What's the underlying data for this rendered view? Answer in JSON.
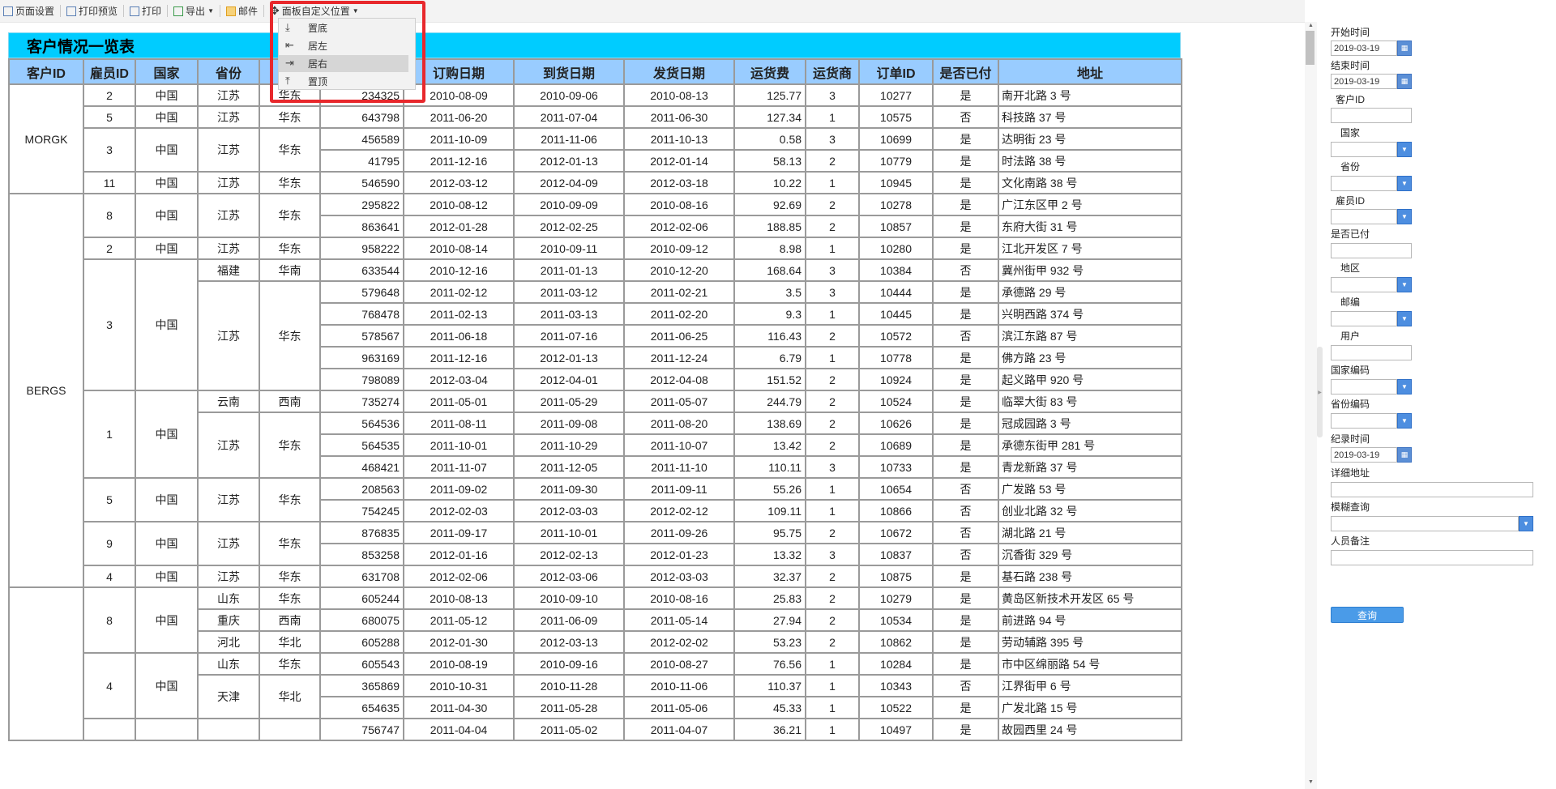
{
  "toolbar": {
    "items": [
      {
        "label": "页面设置",
        "icon": "page-setup-icon"
      },
      {
        "label": "打印预览",
        "icon": "print-preview-icon"
      },
      {
        "label": "打印",
        "icon": "printer-icon"
      },
      {
        "label": "导出",
        "icon": "export-icon"
      },
      {
        "label": "邮件",
        "icon": "mail-icon"
      },
      {
        "label": "面板自定义位置",
        "icon": "move-icon"
      }
    ]
  },
  "panel_menu": {
    "items": [
      {
        "label": "置底",
        "glyph": "⤓",
        "icon": "align-bottom-icon"
      },
      {
        "label": "居左",
        "glyph": "⇤",
        "icon": "align-left-icon"
      },
      {
        "label": "居右",
        "glyph": "⇥",
        "icon": "align-right-icon"
      },
      {
        "label": "置顶",
        "glyph": "⤒",
        "icon": "align-top-icon"
      }
    ],
    "active_index": 2,
    "highlight_color": "#e8282c"
  },
  "report": {
    "title": "客户情况一览表",
    "title_bg": "#00ccff",
    "header_bg": "#99ccff",
    "columns": [
      "客户ID",
      "雇员ID",
      "国家",
      "省份",
      "地",
      "订购日期",
      "到货日期",
      "发货日期",
      "运货费",
      "运货商",
      "订单ID",
      "是否已付",
      "地址"
    ],
    "customers": [
      {
        "name": "MORGK",
        "span": 5
      },
      {
        "name": "BERGS",
        "span": 18
      },
      {
        "name": "",
        "span": 7
      }
    ],
    "employees": [
      {
        "id": "2",
        "country": "中国",
        "span": 1
      },
      {
        "id": "5",
        "country": "中国",
        "span": 1
      },
      {
        "id": "3",
        "country": "中国",
        "span": 2
      },
      {
        "id": "11",
        "country": "中国",
        "span": 1
      },
      {
        "id": "8",
        "country": "中国",
        "span": 2
      },
      {
        "id": "2",
        "country": "中国",
        "span": 1
      },
      {
        "id": "3",
        "country": "中国",
        "span": 6
      },
      {
        "id": "1",
        "country": "中国",
        "span": 4
      },
      {
        "id": "5",
        "country": "中国",
        "span": 2
      },
      {
        "id": "9",
        "country": "中国",
        "span": 2
      },
      {
        "id": "4",
        "country": "中国",
        "span": 1
      },
      {
        "id": "8",
        "country": "中国",
        "span": 3
      },
      {
        "id": "4",
        "country": "中国",
        "span": 3
      },
      {
        "id": "",
        "country": "",
        "span": 1
      }
    ],
    "provinces": [
      {
        "province": "江苏",
        "region": "华东",
        "span": 1
      },
      {
        "province": "江苏",
        "region": "华东",
        "span": 1
      },
      {
        "province": "江苏",
        "region": "华东",
        "span": 2
      },
      {
        "province": "江苏",
        "region": "华东",
        "span": 1
      },
      {
        "province": "江苏",
        "region": "华东",
        "span": 2
      },
      {
        "province": "江苏",
        "region": "华东",
        "span": 1
      },
      {
        "province": "福建",
        "region": "华南",
        "span": 1
      },
      {
        "province": "江苏",
        "region": "华东",
        "span": 5
      },
      {
        "province": "云南",
        "region": "西南",
        "span": 1
      },
      {
        "province": "江苏",
        "region": "华东",
        "span": 3
      },
      {
        "province": "江苏",
        "region": "华东",
        "span": 2
      },
      {
        "province": "江苏",
        "region": "华东",
        "span": 2
      },
      {
        "province": "江苏",
        "region": "华东",
        "span": 1
      },
      {
        "province": "山东",
        "region": "华东",
        "span": 1
      },
      {
        "province": "重庆",
        "region": "西南",
        "span": 1
      },
      {
        "province": "河北",
        "region": "华北",
        "span": 1
      },
      {
        "province": "山东",
        "region": "华东",
        "span": 1
      },
      {
        "province": "天津",
        "region": "华北",
        "span": 2
      },
      {
        "province": "",
        "region": "",
        "span": 1
      }
    ],
    "rows": [
      [
        "234325",
        "2010-08-09",
        "2010-09-06",
        "2010-08-13",
        "125.77",
        "3",
        "10277",
        "是",
        "南开北路 3 号"
      ],
      [
        "643798",
        "2011-06-20",
        "2011-07-04",
        "2011-06-30",
        "127.34",
        "1",
        "10575",
        "否",
        "科技路 37 号"
      ],
      [
        "456589",
        "2011-10-09",
        "2011-11-06",
        "2011-10-13",
        "0.58",
        "3",
        "10699",
        "是",
        "达明街 23 号"
      ],
      [
        "41795",
        "2011-12-16",
        "2012-01-13",
        "2012-01-14",
        "58.13",
        "2",
        "10779",
        "是",
        "时法路 38 号"
      ],
      [
        "546590",
        "2012-03-12",
        "2012-04-09",
        "2012-03-18",
        "10.22",
        "1",
        "10945",
        "是",
        "文化南路 38 号"
      ],
      [
        "295822",
        "2010-08-12",
        "2010-09-09",
        "2010-08-16",
        "92.69",
        "2",
        "10278",
        "是",
        "广江东区甲 2 号"
      ],
      [
        "863641",
        "2012-01-28",
        "2012-02-25",
        "2012-02-06",
        "188.85",
        "2",
        "10857",
        "是",
        "东府大街 31 号"
      ],
      [
        "958222",
        "2010-08-14",
        "2010-09-11",
        "2010-09-12",
        "8.98",
        "1",
        "10280",
        "是",
        "江北开发区 7 号"
      ],
      [
        "633544",
        "2010-12-16",
        "2011-01-13",
        "2010-12-20",
        "168.64",
        "3",
        "10384",
        "否",
        "冀州街甲 932 号"
      ],
      [
        "579648",
        "2011-02-12",
        "2011-03-12",
        "2011-02-21",
        "3.5",
        "3",
        "10444",
        "是",
        "承德路 29 号"
      ],
      [
        "768478",
        "2011-02-13",
        "2011-03-13",
        "2011-02-20",
        "9.3",
        "1",
        "10445",
        "是",
        "兴明西路 374 号"
      ],
      [
        "578567",
        "2011-06-18",
        "2011-07-16",
        "2011-06-25",
        "116.43",
        "2",
        "10572",
        "否",
        "滨江东路 87 号"
      ],
      [
        "963169",
        "2011-12-16",
        "2012-01-13",
        "2011-12-24",
        "6.79",
        "1",
        "10778",
        "是",
        "佛方路 23 号"
      ],
      [
        "798089",
        "2012-03-04",
        "2012-04-01",
        "2012-04-08",
        "151.52",
        "2",
        "10924",
        "是",
        "起义路甲 920 号"
      ],
      [
        "735274",
        "2011-05-01",
        "2011-05-29",
        "2011-05-07",
        "244.79",
        "2",
        "10524",
        "是",
        "临翠大街 83 号"
      ],
      [
        "564536",
        "2011-08-11",
        "2011-09-08",
        "2011-08-20",
        "138.69",
        "2",
        "10626",
        "是",
        "冠成园路 3 号"
      ],
      [
        "564535",
        "2011-10-01",
        "2011-10-29",
        "2011-10-07",
        "13.42",
        "2",
        "10689",
        "是",
        "承德东街甲 281 号"
      ],
      [
        "468421",
        "2011-11-07",
        "2011-12-05",
        "2011-11-10",
        "110.11",
        "3",
        "10733",
        "是",
        "青龙新路 37 号"
      ],
      [
        "208563",
        "2011-09-02",
        "2011-09-30",
        "2011-09-11",
        "55.26",
        "1",
        "10654",
        "否",
        "广发路 53 号"
      ],
      [
        "754245",
        "2012-02-03",
        "2012-03-03",
        "2012-02-12",
        "109.11",
        "1",
        "10866",
        "否",
        "创业北路 32 号"
      ],
      [
        "876835",
        "2011-09-17",
        "2011-10-01",
        "2011-09-26",
        "95.75",
        "2",
        "10672",
        "否",
        "湖北路 21 号"
      ],
      [
        "853258",
        "2012-01-16",
        "2012-02-13",
        "2012-01-23",
        "13.32",
        "3",
        "10837",
        "否",
        "沉香街 329 号"
      ],
      [
        "631708",
        "2012-02-06",
        "2012-03-06",
        "2012-03-03",
        "32.37",
        "2",
        "10875",
        "是",
        "基石路 238 号"
      ],
      [
        "605244",
        "2010-08-13",
        "2010-09-10",
        "2010-08-16",
        "25.83",
        "2",
        "10279",
        "是",
        "黄岛区新技术开发区 65 号"
      ],
      [
        "680075",
        "2011-05-12",
        "2011-06-09",
        "2011-05-14",
        "27.94",
        "2",
        "10534",
        "是",
        "前进路 94 号"
      ],
      [
        "605288",
        "2012-01-30",
        "2012-03-13",
        "2012-02-02",
        "53.23",
        "2",
        "10862",
        "是",
        "劳动辅路 395 号"
      ],
      [
        "605543",
        "2010-08-19",
        "2010-09-16",
        "2010-08-27",
        "76.56",
        "1",
        "10284",
        "是",
        "市中区绵丽路 54 号"
      ],
      [
        "365869",
        "2010-10-31",
        "2010-11-28",
        "2010-11-06",
        "110.37",
        "1",
        "10343",
        "否",
        "江界街甲 6 号"
      ],
      [
        "654635",
        "2011-04-30",
        "2011-05-28",
        "2011-05-06",
        "45.33",
        "1",
        "10522",
        "是",
        "广发北路 15 号"
      ],
      [
        "756747",
        "2011-04-04",
        "2011-05-02",
        "2011-04-07",
        "36.21",
        "1",
        "10497",
        "是",
        "故园西里 24 号"
      ]
    ]
  },
  "form": {
    "start_label": "开始时间",
    "start_value": "2019-03-19",
    "end_label": "结束时间",
    "end_value": "2019-03-19",
    "customer_id_label": "客户ID",
    "country_label": "国家",
    "province_label": "省份",
    "employee_id_label": "雇员ID",
    "paid_label": "是否已付",
    "region_label": "地区",
    "postcode_label": "邮编",
    "user_label": "用户",
    "country_code_label": "国家编码",
    "province_code_label": "省份编码",
    "record_time_label": "纪录时间",
    "record_time_value": "2019-03-19",
    "address_label": "详细地址",
    "fuzzy_label": "模糊查询",
    "remark_label": "人员备注",
    "query_label": "查询",
    "accent": "#4a9be8"
  }
}
